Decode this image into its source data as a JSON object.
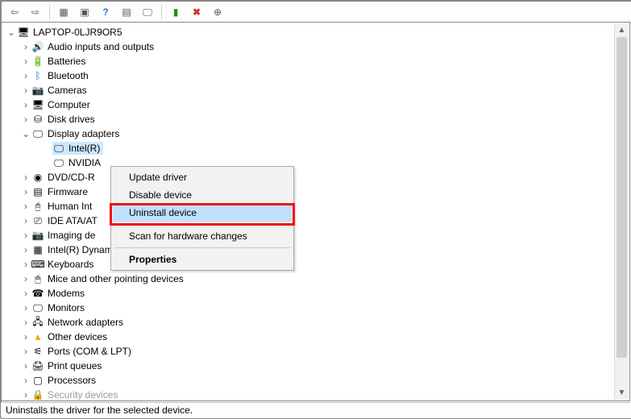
{
  "toolbar": {
    "buttons": [
      {
        "name": "back-icon",
        "glyph": "⇦"
      },
      {
        "name": "forward-icon",
        "glyph": "⇨"
      },
      {
        "sep": true
      },
      {
        "name": "show-hidden-icon",
        "glyph": "▦"
      },
      {
        "name": "refresh-icon",
        "glyph": "▣"
      },
      {
        "name": "help-icon",
        "glyph": "?",
        "color": "#2b7cd3",
        "bold": true
      },
      {
        "name": "properties-icon",
        "glyph": "▤"
      },
      {
        "name": "update-driver-icon",
        "glyph": "🖵"
      },
      {
        "sep": true
      },
      {
        "name": "enable-icon",
        "glyph": "▮",
        "color": "#1a8f1a"
      },
      {
        "name": "disable-icon",
        "glyph": "✖",
        "color": "#d9342b",
        "bold": true
      },
      {
        "name": "uninstall-icon",
        "glyph": "⊕"
      }
    ]
  },
  "tree": {
    "root": {
      "label": "LAPTOP-0LJR9OR5",
      "icon": "🖥",
      "expanded": true
    },
    "items": [
      {
        "label": "Audio inputs and outputs",
        "icon": "🔊",
        "arrow": ">"
      },
      {
        "label": "Batteries",
        "icon": "🔋",
        "arrow": ">"
      },
      {
        "label": "Bluetooth",
        "icon": "ᛒ",
        "arrow": ">",
        "color": "#1d6fd1"
      },
      {
        "label": "Cameras",
        "icon": "📷",
        "arrow": ">"
      },
      {
        "label": "Computer",
        "icon": "🖥",
        "arrow": ">"
      },
      {
        "label": "Disk drives",
        "icon": "⛁",
        "arrow": ">"
      },
      {
        "label": "Display adapters",
        "icon": "🖵",
        "arrow": "v",
        "children": [
          {
            "label": "Intel(R)",
            "icon": "🖵",
            "selected": true,
            "truncated": true
          },
          {
            "label": "NVIDIA",
            "icon": "🖵",
            "truncated": true
          }
        ]
      },
      {
        "label": "DVD/CD-R",
        "icon": "◉",
        "truncated": true,
        "arrow": ">"
      },
      {
        "label": "Firmware",
        "icon": "▤",
        "arrow": ">"
      },
      {
        "label": "Human Int",
        "icon": "🖰",
        "truncated": true,
        "arrow": ">"
      },
      {
        "label": "IDE ATA/AT",
        "icon": "⎚",
        "truncated": true,
        "arrow": ">"
      },
      {
        "label": "Imaging de",
        "icon": "📷",
        "truncated": true,
        "arrow": ">"
      },
      {
        "label": "Intel(R) Dynamic Platform and Thermal Framework",
        "icon": "▦",
        "arrow": ">"
      },
      {
        "label": "Keyboards",
        "icon": "⌨",
        "arrow": ">"
      },
      {
        "label": "Mice and other pointing devices",
        "icon": "🖱",
        "arrow": ">"
      },
      {
        "label": "Modems",
        "icon": "☎",
        "arrow": ">"
      },
      {
        "label": "Monitors",
        "icon": "🖵",
        "arrow": ">"
      },
      {
        "label": "Network adapters",
        "icon": "🖧",
        "arrow": ">"
      },
      {
        "label": "Other devices",
        "icon": "▲",
        "arrow": ">",
        "color": "#e6b400"
      },
      {
        "label": "Ports (COM & LPT)",
        "icon": "⚟",
        "arrow": ">"
      },
      {
        "label": "Print queues",
        "icon": "🖨",
        "arrow": ">"
      },
      {
        "label": "Processors",
        "icon": "▢",
        "arrow": ">"
      },
      {
        "label": "Security devices",
        "icon": "🔒",
        "arrow": ">",
        "dim": true
      }
    ]
  },
  "context_menu": {
    "items": [
      {
        "label": "Update driver"
      },
      {
        "label": "Disable device"
      },
      {
        "label": "Uninstall device",
        "hover": true,
        "highlight": true
      },
      {
        "sep": true
      },
      {
        "label": "Scan for hardware changes"
      },
      {
        "sep": true
      },
      {
        "label": "Properties",
        "bold": true
      }
    ]
  },
  "statusbar": {
    "text": "Uninstalls the driver for the selected device."
  }
}
